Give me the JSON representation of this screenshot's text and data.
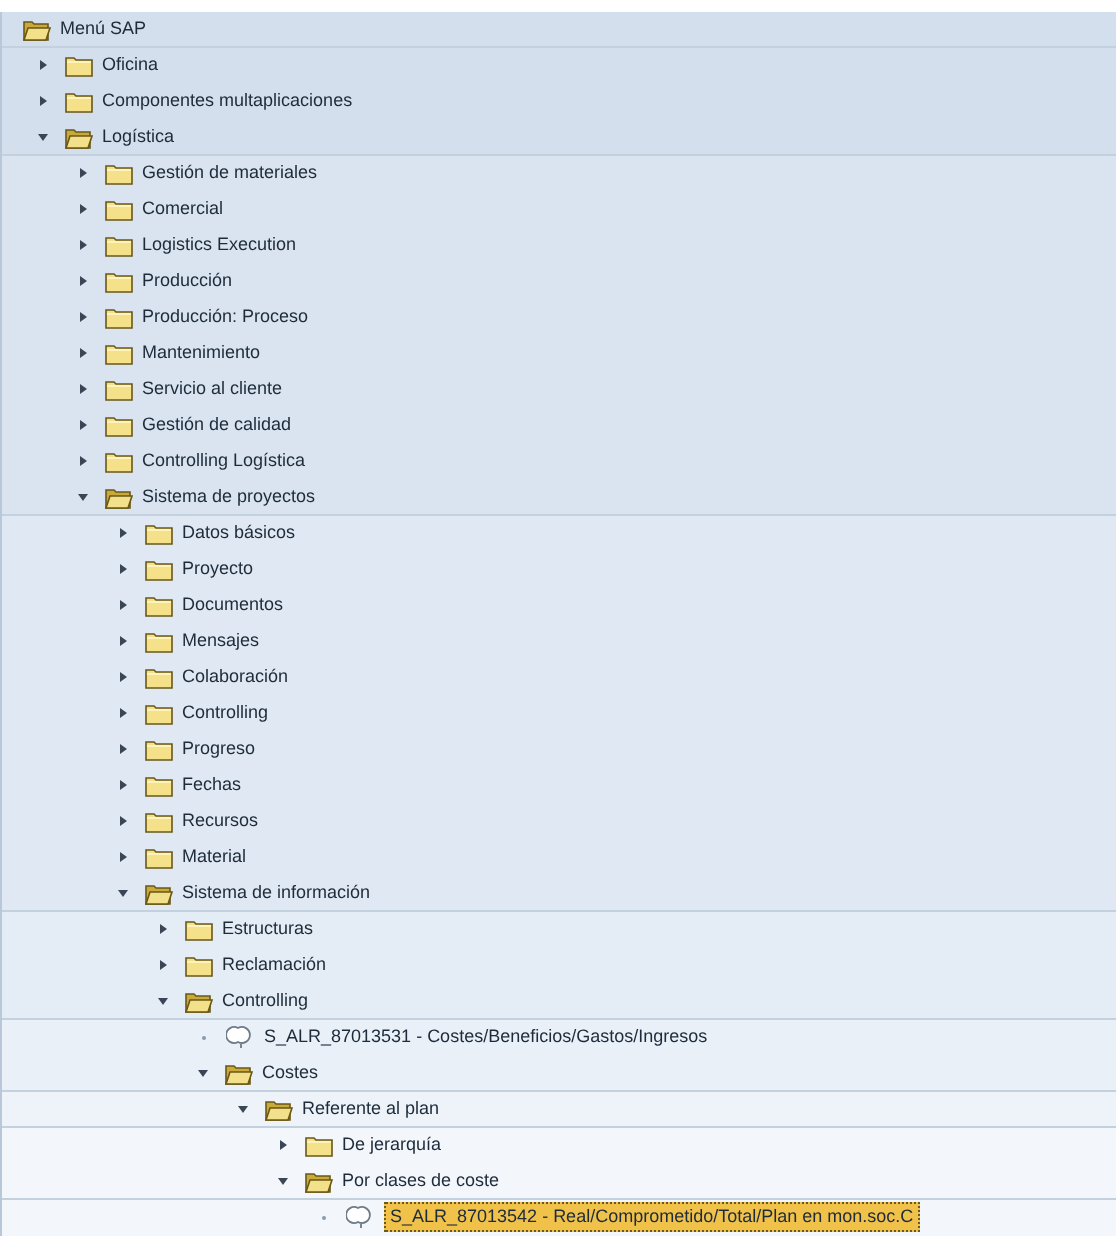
{
  "menu": {
    "title": "Menú SAP",
    "selected": false,
    "children": [
      {
        "label": "Oficina",
        "kind": "folder",
        "expanded": false,
        "selected": false
      },
      {
        "label": "Componentes multaplicaciones",
        "kind": "folder",
        "expanded": false,
        "selected": false
      },
      {
        "label": "Logística",
        "kind": "folder",
        "expanded": true,
        "selected": false,
        "children": [
          {
            "label": "Gestión de materiales",
            "kind": "folder",
            "expanded": false,
            "selected": false
          },
          {
            "label": "Comercial",
            "kind": "folder",
            "expanded": false,
            "selected": false
          },
          {
            "label": "Logistics Execution",
            "kind": "folder",
            "expanded": false,
            "selected": false
          },
          {
            "label": "Producción",
            "kind": "folder",
            "expanded": false,
            "selected": false
          },
          {
            "label": "Producción: Proceso",
            "kind": "folder",
            "expanded": false,
            "selected": false
          },
          {
            "label": "Mantenimiento",
            "kind": "folder",
            "expanded": false,
            "selected": false
          },
          {
            "label": "Servicio al cliente",
            "kind": "folder",
            "expanded": false,
            "selected": false
          },
          {
            "label": "Gestión de calidad",
            "kind": "folder",
            "expanded": false,
            "selected": false
          },
          {
            "label": "Controlling Logística",
            "kind": "folder",
            "expanded": false,
            "selected": false
          },
          {
            "label": "Sistema de proyectos",
            "kind": "folder",
            "expanded": true,
            "selected": false,
            "children": [
              {
                "label": "Datos básicos",
                "kind": "folder",
                "expanded": false,
                "selected": false
              },
              {
                "label": "Proyecto",
                "kind": "folder",
                "expanded": false,
                "selected": false
              },
              {
                "label": "Documentos",
                "kind": "folder",
                "expanded": false,
                "selected": false
              },
              {
                "label": "Mensajes",
                "kind": "folder",
                "expanded": false,
                "selected": false
              },
              {
                "label": "Colaboración",
                "kind": "folder",
                "expanded": false,
                "selected": false
              },
              {
                "label": "Controlling",
                "kind": "folder",
                "expanded": false,
                "selected": false
              },
              {
                "label": "Progreso",
                "kind": "folder",
                "expanded": false,
                "selected": false
              },
              {
                "label": "Fechas",
                "kind": "folder",
                "expanded": false,
                "selected": false
              },
              {
                "label": "Recursos",
                "kind": "folder",
                "expanded": false,
                "selected": false
              },
              {
                "label": "Material",
                "kind": "folder",
                "expanded": false,
                "selected": false
              },
              {
                "label": "Sistema de información",
                "kind": "folder",
                "expanded": true,
                "selected": false,
                "children": [
                  {
                    "label": "Estructuras",
                    "kind": "folder",
                    "expanded": false,
                    "selected": false
                  },
                  {
                    "label": "Reclamación",
                    "kind": "folder",
                    "expanded": false,
                    "selected": false
                  },
                  {
                    "label": "Controlling",
                    "kind": "folder",
                    "expanded": true,
                    "selected": false,
                    "children": [
                      {
                        "label": "S_ALR_87013531 - Costes/Beneficios/Gastos/Ingresos",
                        "kind": "report",
                        "selected": false
                      },
                      {
                        "label": "Costes",
                        "kind": "folder",
                        "expanded": true,
                        "selected": false,
                        "children": [
                          {
                            "label": "Referente al plan",
                            "kind": "folder",
                            "expanded": true,
                            "selected": false,
                            "children": [
                              {
                                "label": "De jerarquía",
                                "kind": "folder",
                                "expanded": false,
                                "selected": false
                              },
                              {
                                "label": "Por clases de coste",
                                "kind": "folder",
                                "expanded": true,
                                "selected": false,
                                "children": [
                                  {
                                    "label": "S_ALR_87013542 - Real/Comprometido/Total/Plan en mon.soc.C",
                                    "kind": "report",
                                    "selected": true
                                  }
                                ]
                              }
                            ]
                          }
                        ]
                      }
                    ]
                  }
                ]
              }
            ]
          }
        ]
      }
    ]
  }
}
